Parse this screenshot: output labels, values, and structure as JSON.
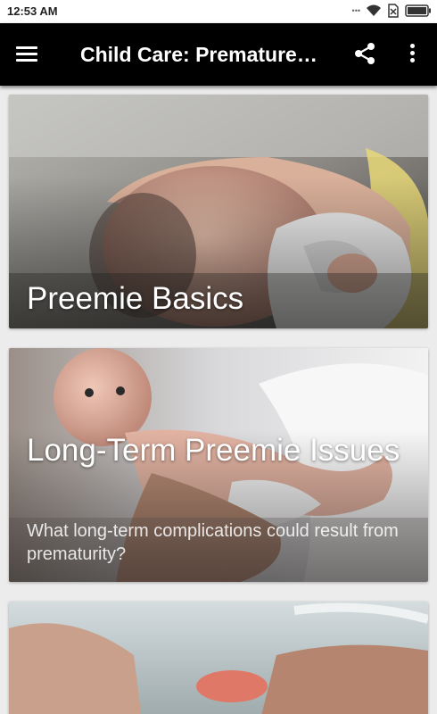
{
  "status_bar": {
    "time": "12:53 AM",
    "icons": [
      "signal-dots-icon",
      "wifi-icon",
      "no-sim-icon",
      "battery-icon"
    ]
  },
  "app_bar": {
    "title": "Child Care: Premature…",
    "menu_icon": "hamburger-menu-icon",
    "share_icon": "share-icon",
    "more_icon": "more-vert-icon",
    "background": "#000000"
  },
  "cards": [
    {
      "title": "Preemie Basics",
      "subtitle": ""
    },
    {
      "title": "Long-Term Preemie Issues",
      "subtitle": "What long-term complications could result from prematurity?"
    },
    {
      "title": "",
      "subtitle": ""
    }
  ]
}
